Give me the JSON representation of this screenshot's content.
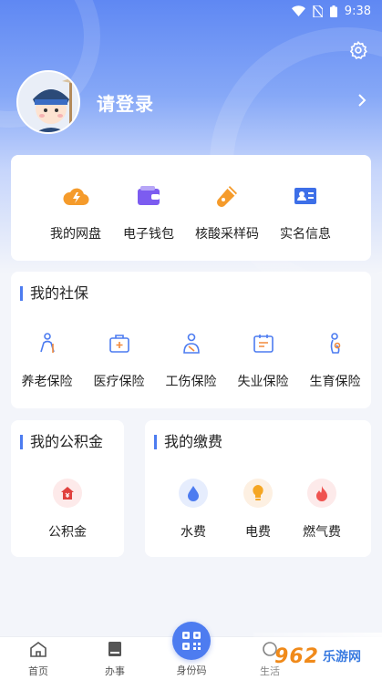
{
  "status_bar": {
    "time": "9:38"
  },
  "profile": {
    "login_label": "请登录"
  },
  "quick_actions": [
    {
      "label": "我的网盘",
      "icon": "cloud-icon"
    },
    {
      "label": "电子钱包",
      "icon": "wallet-icon"
    },
    {
      "label": "核酸采样码",
      "icon": "test-tube-icon"
    },
    {
      "label": "实名信息",
      "icon": "id-card-icon"
    }
  ],
  "social_security": {
    "title": "我的社保",
    "items": [
      {
        "label": "养老保险",
        "icon": "elderly-icon"
      },
      {
        "label": "医疗保险",
        "icon": "medical-kit-icon"
      },
      {
        "label": "工伤保险",
        "icon": "injury-icon"
      },
      {
        "label": "失业保险",
        "icon": "unemployment-icon"
      },
      {
        "label": "生育保险",
        "icon": "maternity-icon"
      }
    ]
  },
  "housing_fund": {
    "title": "我的公积金",
    "items": [
      {
        "label": "公积金",
        "icon": "house-fund-icon"
      }
    ]
  },
  "payments": {
    "title": "我的缴费",
    "items": [
      {
        "label": "水费",
        "icon": "water-drop-icon"
      },
      {
        "label": "电费",
        "icon": "light-bulb-icon"
      },
      {
        "label": "燃气费",
        "icon": "flame-icon"
      }
    ]
  },
  "tabbar": {
    "items": [
      {
        "label": "首页",
        "icon": "home-icon"
      },
      {
        "label": "办事",
        "icon": "book-icon"
      },
      {
        "label": "身份码",
        "icon": "qr-code-icon"
      },
      {
        "label": "生活",
        "icon": "life-icon"
      }
    ]
  },
  "watermark": {
    "text": "962",
    "sub": "乐游网"
  },
  "colors": {
    "accent": "#4d7cf0",
    "hero_top": "#5f88f3",
    "water": "#4d7cf0",
    "electric": "#f5a623",
    "gas": "#ef5350",
    "fund": "#e0413e"
  }
}
